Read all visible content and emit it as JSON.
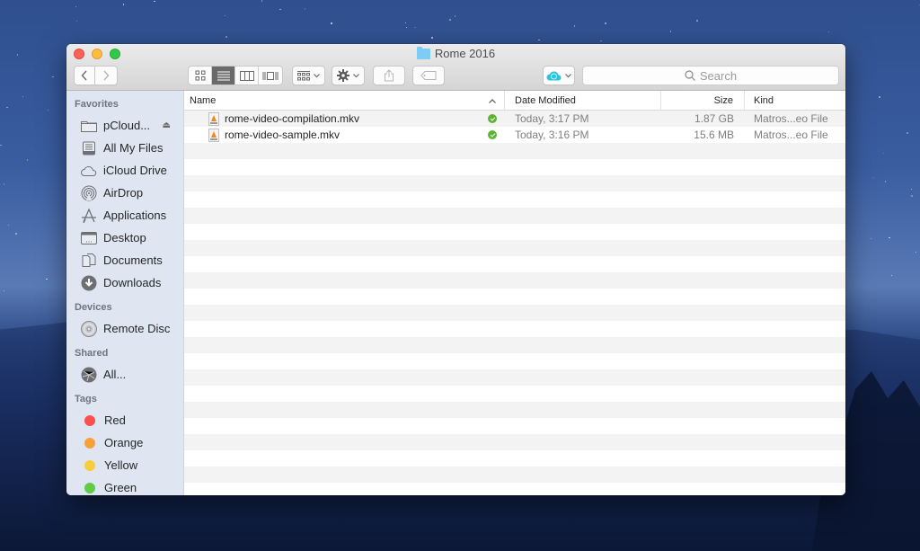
{
  "window": {
    "title": "Rome 2016",
    "title_icon": "folder-icon"
  },
  "toolbar": {
    "back_icon": "chevron-left-icon",
    "forward_icon": "chevron-right-icon",
    "view_modes": [
      {
        "name": "icon-view",
        "icon": "grid-icon",
        "active": false
      },
      {
        "name": "list-view",
        "icon": "list-icon",
        "active": true
      },
      {
        "name": "column-view",
        "icon": "columns-icon",
        "active": false
      },
      {
        "name": "cover-flow-view",
        "icon": "coverflow-icon",
        "active": false
      }
    ],
    "arrange_icon": "arrange-icon",
    "action_icon": "gear-icon",
    "share_icon": "share-icon",
    "tag_icon": "tag-icon",
    "pcloud_icon": "pcloud-icon",
    "search_placeholder": "Search"
  },
  "sidebar": {
    "sections": [
      {
        "heading": "Favorites",
        "items": [
          {
            "label": "pCloud...",
            "icon": "folder-icon",
            "eject": true
          },
          {
            "label": "All My Files",
            "icon": "all-files-icon"
          },
          {
            "label": "iCloud Drive",
            "icon": "cloud-icon"
          },
          {
            "label": "AirDrop",
            "icon": "airdrop-icon"
          },
          {
            "label": "Applications",
            "icon": "applications-icon"
          },
          {
            "label": "Desktop",
            "icon": "desktop-icon"
          },
          {
            "label": "Documents",
            "icon": "documents-icon"
          },
          {
            "label": "Downloads",
            "icon": "downloads-icon"
          }
        ]
      },
      {
        "heading": "Devices",
        "items": [
          {
            "label": "Remote Disc",
            "icon": "disc-icon"
          }
        ]
      },
      {
        "heading": "Shared",
        "items": [
          {
            "label": "All...",
            "icon": "network-icon"
          }
        ]
      },
      {
        "heading": "Tags",
        "items": [
          {
            "label": "Red",
            "color": "#fc4f4f"
          },
          {
            "label": "Orange",
            "color": "#f6a23a"
          },
          {
            "label": "Yellow",
            "color": "#f8cd3d"
          },
          {
            "label": "Green",
            "color": "#5fcb46"
          }
        ]
      }
    ]
  },
  "columns": {
    "name": "Name",
    "date": "Date Modified",
    "size": "Size",
    "kind": "Kind",
    "sort_indicator": "^"
  },
  "files": [
    {
      "name": "rome-video-compilation.mkv",
      "date": "Today, 3:17 PM",
      "size": "1.87 GB",
      "kind": "Matros...eo File",
      "sync_status": "synced"
    },
    {
      "name": "rome-video-sample.mkv",
      "date": "Today, 3:16 PM",
      "size": "15.6 MB",
      "kind": "Matros...eo File",
      "sync_status": "synced"
    }
  ],
  "colors": {
    "sync_green": "#5cb531",
    "folder_blue": "#7ecbf3",
    "pcloud_teal": "#2bc6dc"
  }
}
